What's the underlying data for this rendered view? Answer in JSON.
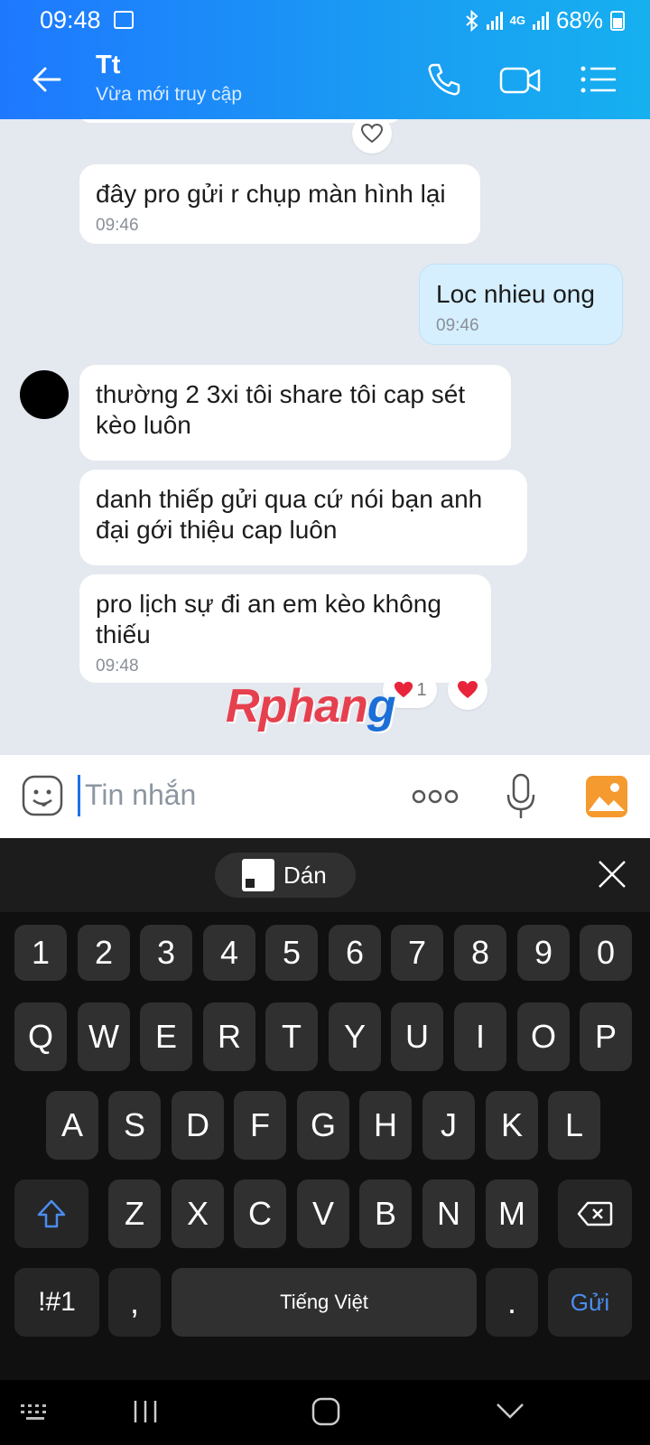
{
  "status": {
    "time": "09:48",
    "network": "4G",
    "battery": "68%"
  },
  "header": {
    "contact_name": "Tt",
    "presence": "Vừa mới truy cập"
  },
  "messages": [
    {
      "text": "đây pro gửi r chụp màn hình lại",
      "time": "09:46",
      "from": "them"
    },
    {
      "text": "Loc nhieu ong",
      "time": "09:46",
      "from": "me"
    },
    {
      "text": "thường 2 3xi tôi share tôi cap sét kèo luôn",
      "from": "them"
    },
    {
      "text": "danh thiếp gửi qua cứ nói bạn anh đại gới thiệu cap luôn",
      "from": "them"
    },
    {
      "text": "pro lịch sự đi an  em kèo không thiếu",
      "time": "09:48",
      "from": "them"
    }
  ],
  "reaction": {
    "count": "1"
  },
  "watermark": {
    "part1": "Rphan",
    "part2": "g"
  },
  "composer": {
    "placeholder": "Tin nhắn"
  },
  "keyboard": {
    "paste_label": "Dán",
    "row_numbers": [
      "1",
      "2",
      "3",
      "4",
      "5",
      "6",
      "7",
      "8",
      "9",
      "0"
    ],
    "row1": [
      "Q",
      "W",
      "E",
      "R",
      "T",
      "Y",
      "U",
      "I",
      "O",
      "P"
    ],
    "row2": [
      "A",
      "S",
      "D",
      "F",
      "G",
      "H",
      "J",
      "K",
      "L"
    ],
    "row3": [
      "Z",
      "X",
      "C",
      "V",
      "B",
      "N",
      "M"
    ],
    "symbols_key": "!#1",
    "comma_key": ",",
    "space_label": "Tiếng Việt",
    "period_key": ".",
    "send_label": "Gửi"
  }
}
